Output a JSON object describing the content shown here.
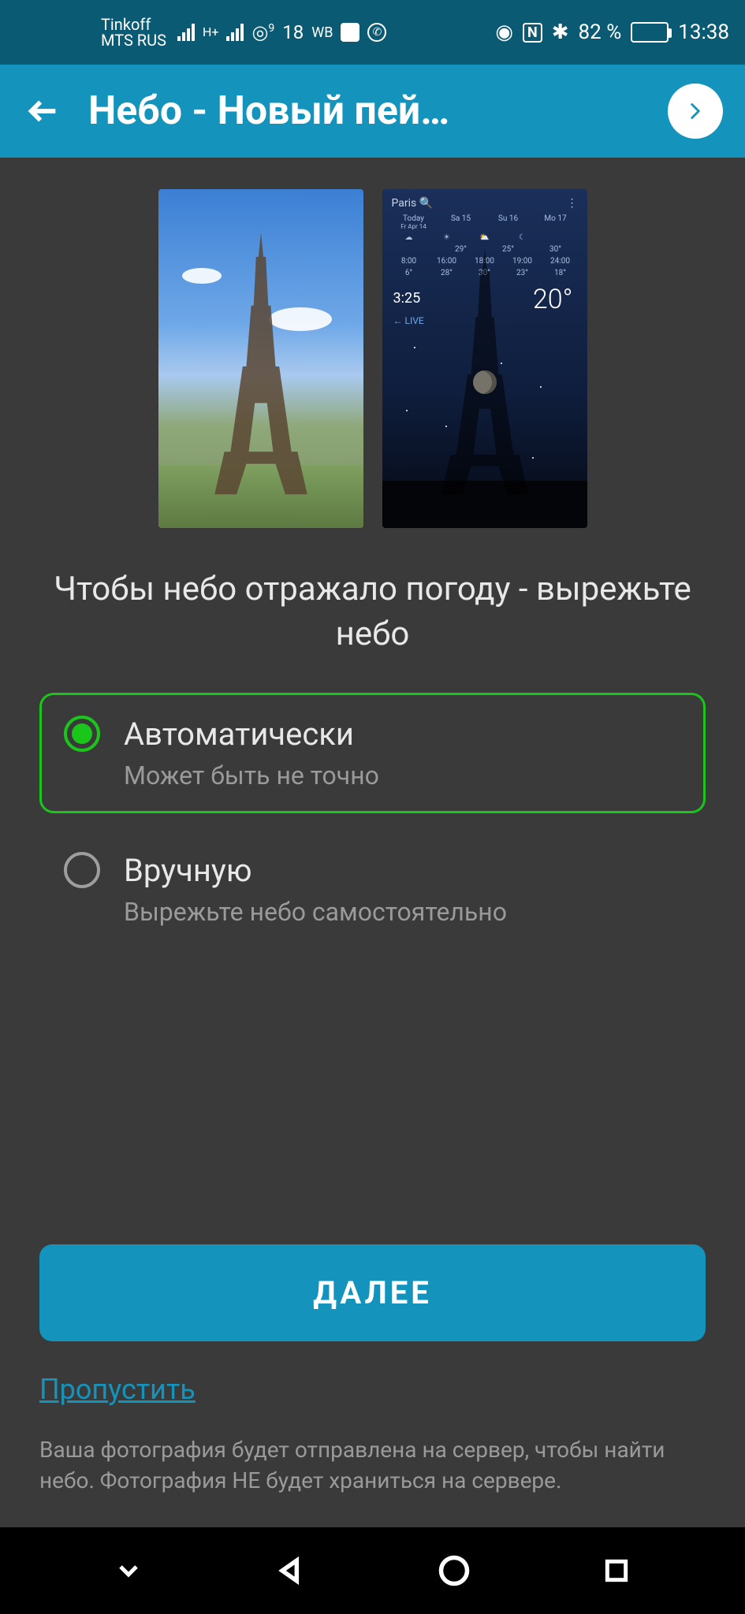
{
  "status": {
    "carrier1": "Tinkoff",
    "carrier2": "MTS RUS",
    "temp": "18",
    "temp_sup": "9",
    "wb": "WB",
    "battery_pct": "82 %",
    "time": "13:38",
    "hplus": "H+"
  },
  "app_bar": {
    "title": "Небо - Новый пей…"
  },
  "preview_night": {
    "search": "Paris",
    "today_label": "Today",
    "today_sub": "Fr Apr 14",
    "days": [
      "Sa 15",
      "Su 16",
      "Mo 17"
    ],
    "highs": [
      "29°",
      "25°",
      "30°"
    ],
    "cond_row": [
      "8:00",
      "16:00",
      "18:00",
      "19:00",
      "24:00"
    ],
    "temps_row": [
      "6°",
      "28°",
      "30°",
      "23°",
      "18°"
    ],
    "big_temp": "20°",
    "time": "3:25",
    "live": "← LIVE"
  },
  "instruction": "Чтобы небо отражало погоду - вырежьте небо",
  "options": [
    {
      "title": "Автоматически",
      "sub": "Может быть не точно",
      "selected": true
    },
    {
      "title": "Вручную",
      "sub": "Вырежьте небо самостоятельно",
      "selected": false
    }
  ],
  "next_button": "ДАЛЕЕ",
  "skip_link": "Пропустить",
  "disclaimer": "Ваша фотография будет отправлена на сервер, чтобы найти небо. Фотография НЕ будет храниться на сервере."
}
